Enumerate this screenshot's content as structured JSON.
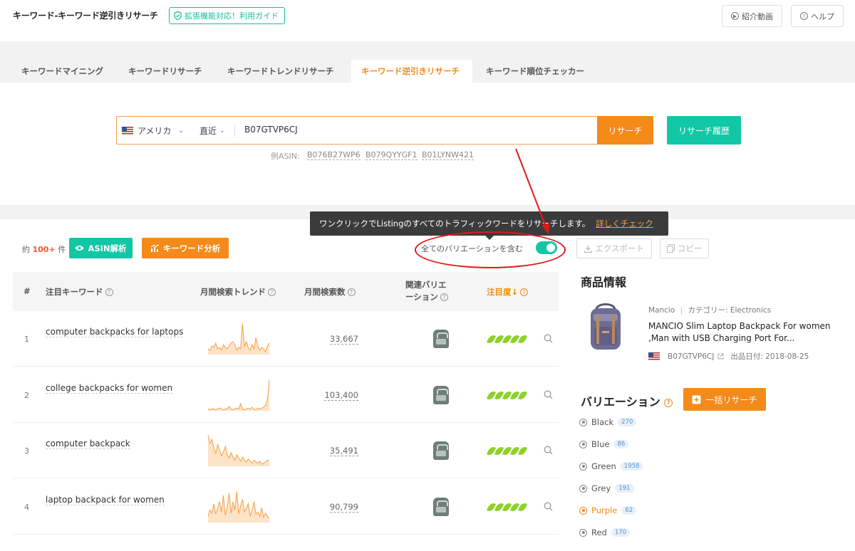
{
  "header": {
    "title": "キーワード-キーワード逆引きリサーチ",
    "guide_badge": "拡張機能対応！利用ガイド",
    "video_button": "紹介動画",
    "help_button": "ヘルプ"
  },
  "tabs": [
    {
      "label": "キーワードマイニング",
      "active": false
    },
    {
      "label": "キーワードリサーチ",
      "active": false
    },
    {
      "label": "キーワードトレンドリサーチ",
      "active": false
    },
    {
      "label": "キーワード逆引きリサーチ",
      "active": true
    },
    {
      "label": "キーワード順位チェッカー",
      "active": false
    }
  ],
  "search": {
    "country": "アメリカ",
    "period": "直近",
    "value": "B07GTVP6CJ",
    "search_button": "リサーチ",
    "history_button": "リサーチ履歴",
    "example_label": "例ASIN:",
    "examples": [
      "B076B27WP6",
      "B079QYYGF1",
      "B01LYNW421"
    ]
  },
  "tooltip": {
    "text": "ワンクリックでListingのすべてのトラフィックワードをリサーチします。",
    "link": "詳しくチェック"
  },
  "toolbar": {
    "count_prefix": "約",
    "count_value": "100+",
    "count_suffix": "件",
    "asin_button": "ASIN解析",
    "keyword_button": "キーワード分析",
    "variation_label": "全てのバリエーションを含む",
    "variation_toggle_on": true,
    "export_button": "エクスポート",
    "copy_button": "コピー"
  },
  "table": {
    "headers": {
      "num": "#",
      "keyword": "注目キーワード",
      "trend": "月間検索トレンド",
      "volume": "月間検索数",
      "variation_line1": "関連バリエ",
      "variation_line2": "ーション",
      "attention": "注目度↓"
    },
    "rows": [
      {
        "num": "1",
        "keyword": "computer backpacks for laptops",
        "volume": "33,667",
        "attention": 5,
        "trend": [
          4,
          3,
          6,
          5,
          8,
          4,
          5,
          3,
          7,
          5,
          4,
          6,
          8,
          9,
          7,
          3,
          5,
          4,
          22,
          6,
          9,
          5,
          3,
          7,
          4,
          12,
          6,
          3,
          5,
          4,
          2,
          6,
          8
        ]
      },
      {
        "num": "2",
        "keyword": "college backpacks for women",
        "volume": "103,400",
        "attention": 5,
        "trend": [
          2,
          1,
          2,
          2,
          1,
          2,
          3,
          2,
          1,
          2,
          2,
          5,
          2,
          1,
          2,
          3,
          2,
          8,
          2,
          1,
          2,
          3,
          2,
          4,
          2,
          1,
          3,
          2,
          3,
          4,
          6,
          12,
          35
        ]
      },
      {
        "num": "3",
        "keyword": "computer backpack",
        "volume": "35,491",
        "attention": 5,
        "trend": [
          30,
          22,
          26,
          18,
          12,
          21,
          16,
          10,
          14,
          19,
          11,
          8,
          13,
          9,
          6,
          11,
          8,
          5,
          9,
          6,
          4,
          7,
          5,
          3,
          6,
          4,
          3,
          5,
          2,
          3,
          4,
          6,
          5
        ]
      },
      {
        "num": "4",
        "keyword": "laptop backpack for women",
        "volume": "90,799",
        "attention": 5,
        "trend": [
          6,
          12,
          9,
          18,
          8,
          14,
          20,
          10,
          26,
          7,
          15,
          28,
          9,
          20,
          12,
          30,
          8,
          16,
          22,
          10,
          14,
          18,
          6,
          12,
          20,
          8,
          10,
          6,
          14,
          5,
          9,
          6,
          4
        ]
      }
    ]
  },
  "product": {
    "section_title": "商品情報",
    "brand": "Mancio",
    "category": "カテゴリー: Electronics",
    "name": "MANCIO Slim Laptop Backpack For women ,Man with USB Charging Port For...",
    "asin": "B07GTVP6CJ",
    "date": "出品日付: 2018-08-25"
  },
  "variations": {
    "title": "バリエーション",
    "bulk_button": "一括リサーチ",
    "items": [
      {
        "name": "Black",
        "count": "270",
        "selected": false
      },
      {
        "name": "Blue",
        "count": "86",
        "selected": false
      },
      {
        "name": "Green",
        "count": "1958",
        "selected": false
      },
      {
        "name": "Grey",
        "count": "191",
        "selected": false
      },
      {
        "name": "Purple",
        "count": "62",
        "selected": true
      },
      {
        "name": "Red",
        "count": "170",
        "selected": false
      }
    ]
  },
  "colors": {
    "accent_orange": "#f48a1a",
    "accent_green": "#12c7a5",
    "annotation_red": "#e0191b"
  }
}
